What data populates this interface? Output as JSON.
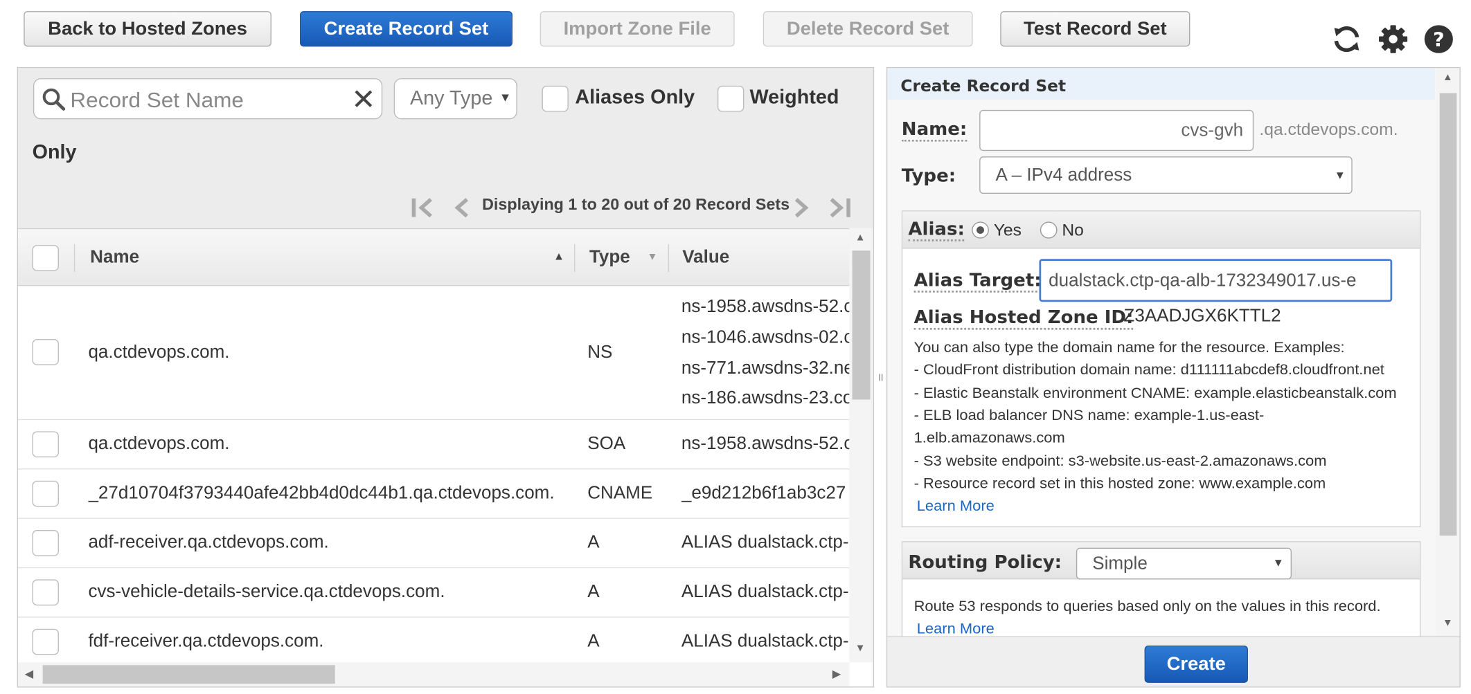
{
  "toolbar": {
    "back_label": "Back to Hosted Zones",
    "create_label": "Create Record Set",
    "import_label": "Import Zone File",
    "delete_label": "Delete Record Set",
    "test_label": "Test Record Set",
    "icons": [
      "refresh-icon",
      "gear-icon",
      "help-icon"
    ]
  },
  "filters": {
    "search_placeholder": "Record Set Name",
    "type_value": "Any Type",
    "aliases_only": "Aliases Only",
    "weighted": "Weighted",
    "weighted_cont": "Only"
  },
  "pager": {
    "text": "Displaying 1 to 20 out of 20 Record Sets"
  },
  "table": {
    "columns": [
      "Name",
      "Type",
      "Value"
    ],
    "rows": [
      {
        "name": "qa.ctdevops.com.",
        "type": "NS",
        "values": [
          "ns-1958.awsdns-52.c",
          "ns-1046.awsdns-02.c",
          "ns-771.awsdns-32.ne",
          "ns-186.awsdns-23.co"
        ]
      },
      {
        "name": "qa.ctdevops.com.",
        "type": "SOA",
        "values": [
          "ns-1958.awsdns-52.c"
        ]
      },
      {
        "name": "_27d10704f3793440afe42bb4d0dc44b1.qa.ctdevops.com.",
        "type": "CNAME",
        "values": [
          "_e9d212b6f1ab3c27"
        ]
      },
      {
        "name": "adf-receiver.qa.ctdevops.com.",
        "type": "A",
        "values": [
          "ALIAS dualstack.ctp-"
        ]
      },
      {
        "name": "cvs-vehicle-details-service.qa.ctdevops.com.",
        "type": "A",
        "values": [
          "ALIAS dualstack.ctp-"
        ]
      },
      {
        "name": "fdf-receiver.qa.ctdevops.com.",
        "type": "A",
        "values": [
          "ALIAS dualstack.ctp-"
        ]
      }
    ]
  },
  "form": {
    "header": "Create Record Set",
    "name_label": "Name:",
    "name_value": "cvs-gvh",
    "name_suffix": ".qa.ctdevops.com.",
    "type_label": "Type:",
    "type_value": "A – IPv4 address",
    "alias_label": "Alias:",
    "alias_yes": "Yes",
    "alias_no": "No",
    "alias_selected": "Yes",
    "alias_target_label": "Alias Target:",
    "alias_target_value": "dualstack.ctp-qa-alb-1732349017.us-e",
    "zone_id_label": "Alias Hosted Zone ID:",
    "zone_id_value": "Z3AADJGX6KTTL2",
    "help_lines": [
      "You can also type the domain name for the resource. Examples:",
      "-  CloudFront distribution domain name: d111111abcdef8.cloudfront.net",
      "-  Elastic Beanstalk environment CNAME: example.elasticbeanstalk.com",
      "-  ELB load balancer DNS name: example-1.us-east-",
      "1.elb.amazonaws.com",
      "-  S3 website endpoint: s3-website.us-east-2.amazonaws.com",
      "-  Resource record set in this hosted zone: www.example.com"
    ],
    "learn_more": "Learn More",
    "routing_label": "Routing Policy:",
    "routing_value": "Simple",
    "routing_help": "Route 53 responds to queries based only on the values in this record.",
    "routing_learn_more": "Learn More",
    "create_button": "Create"
  },
  "colors": {
    "primary": "#1f66c5",
    "link": "#1a66c4",
    "header_tint": "#e9f1fb"
  }
}
